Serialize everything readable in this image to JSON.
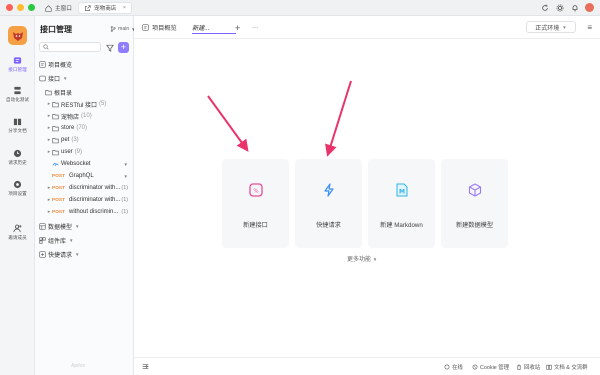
{
  "window": {
    "tabs": [
      {
        "label": "主窗口",
        "icon": "home-icon"
      },
      {
        "label": "宠物商店",
        "icon": "external-link-icon"
      }
    ],
    "close_glyph": "×"
  },
  "rail": {
    "items": [
      {
        "label": "接口管理",
        "icon": "api-icon"
      },
      {
        "label": "自动化测试",
        "icon": "test-icon"
      },
      {
        "label": "分享文档",
        "icon": "book-icon"
      },
      {
        "label": "请求历史",
        "icon": "clock-icon"
      },
      {
        "label": "项目设置",
        "icon": "settings-icon"
      },
      {
        "label": "邀请成员",
        "icon": "user-plus-icon"
      }
    ]
  },
  "sidebar": {
    "title": "接口管理",
    "branch": "main",
    "search_placeholder": "",
    "tree": {
      "overview": "项目概览",
      "api": "接口",
      "root": "根目录",
      "folders": [
        {
          "label": "RESTful 接口",
          "count": "(5)"
        },
        {
          "label": "宠物店",
          "count": "(10)"
        },
        {
          "label": "store",
          "count": "(70)"
        },
        {
          "label": "pet",
          "count": "(3)"
        },
        {
          "label": "user",
          "count": "(9)"
        }
      ],
      "endpoints": [
        {
          "method": "",
          "label": "Websocket",
          "count": ""
        },
        {
          "method": "POST",
          "label": "GraphQL",
          "count": ""
        },
        {
          "method": "POST",
          "label": "discriminator with...",
          "count": "(1)"
        },
        {
          "method": "POST",
          "label": "discriminator with...",
          "count": "(1)"
        },
        {
          "method": "POST",
          "label": "without discrimin...",
          "count": "(1)"
        }
      ],
      "data_models": "数据模型",
      "components": "组件库",
      "quick_requests": "快捷请求"
    },
    "footer": "Apifox"
  },
  "main": {
    "tabs": [
      {
        "label": "项目概览"
      },
      {
        "label": "新建..."
      }
    ],
    "plus": "+",
    "more_dots": "···",
    "environment": "正式环境",
    "cards": [
      {
        "label": "新建接口",
        "icon": "api-badge-icon",
        "color": "#e84d9a"
      },
      {
        "label": "快捷请求",
        "icon": "lightning-icon",
        "color": "#3b8ff5"
      },
      {
        "label": "新建 Markdown",
        "icon": "markdown-icon",
        "color": "#2fb4e8"
      },
      {
        "label": "新建数据模型",
        "icon": "cube-icon",
        "color": "#9b7bf5"
      }
    ],
    "more_features": "更多功能"
  },
  "statusbar": {
    "online": "在线",
    "cookie": "Cookie 管理",
    "recycle": "回收站",
    "docs": "文档 & 交流群"
  },
  "colors": {
    "accent": "#7b61ff",
    "arrow": "#e8336b",
    "post": "#f08a3e"
  }
}
